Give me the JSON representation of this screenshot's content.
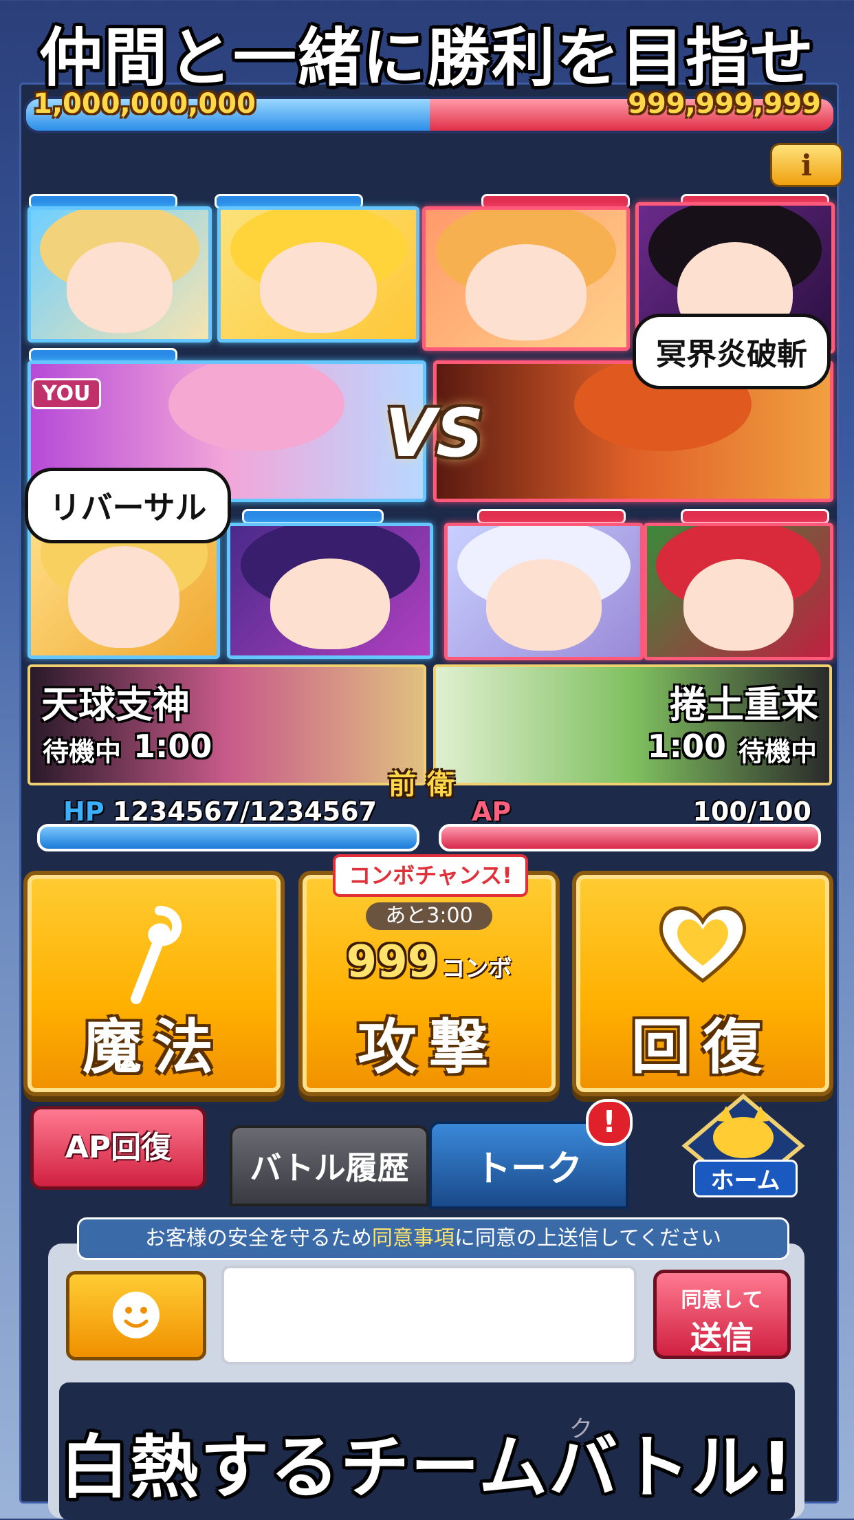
{
  "promo": {
    "headline": "仲間と一緒に勝利を目指せ",
    "footer": "白熱するチームバトル!"
  },
  "score": {
    "left": "1,000,000,000",
    "right": "999,999,999",
    "left_fraction": 0.5
  },
  "info_button": "i",
  "battle": {
    "you_badge": "YOU",
    "vs_label": "VS",
    "bubble_left": "リバーサル",
    "bubble_right": "冥界炎破斬",
    "leader_left": {
      "name": "天球支神",
      "status": "待機中",
      "time": "1:00"
    },
    "leader_right": {
      "name": "捲土重来",
      "status": "待機中",
      "time": "1:00"
    },
    "position_label": "前衛"
  },
  "stats": {
    "hp_label": "HP",
    "hp_value": "1234567/1234567",
    "ap_label": "AP",
    "ap_value": "100/100"
  },
  "actions": {
    "magic": "魔法",
    "attack": "攻撃",
    "heal": "回復",
    "combo_chance": "コンボチャンス!",
    "combo_timer": "あと3:00",
    "combo_count": "999",
    "combo_unit": "コンボ"
  },
  "bottom": {
    "ap_recover": "AP回復",
    "tab_history": "バトル履歴",
    "tab_talk": "トーク",
    "notification": "!",
    "home": "ホーム"
  },
  "chat": {
    "notice_prefix": "お客様の安全を守るため",
    "notice_link": "同意事項",
    "notice_suffix": "に同意の上送信してください",
    "send_line1": "同意して",
    "send_line2": "送信",
    "partial_text": "ク"
  },
  "colors": {
    "team_blue": "#2a8ae6",
    "team_red": "#e03050",
    "button_gold": "#ffb000"
  }
}
